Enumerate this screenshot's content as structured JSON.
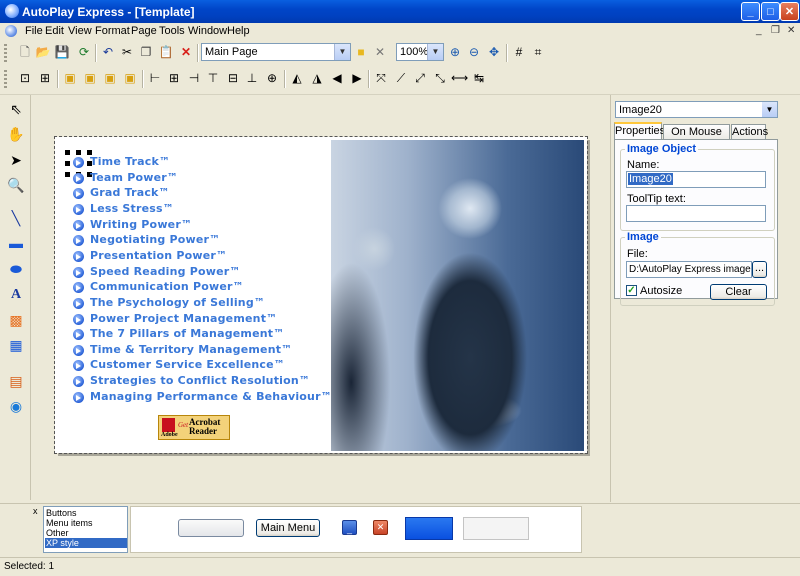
{
  "window": {
    "title": "AutoPlay Express - [Template]"
  },
  "menu": [
    "File",
    "Edit",
    "View",
    "Format",
    "Page",
    "Tools",
    "Window",
    "Help"
  ],
  "toolbar": {
    "page_combo_value": "Main Page",
    "zoom_combo_value": "100%"
  },
  "canvas": {
    "links": [
      "Time Track™",
      "Team Power™",
      "Grad Track™",
      "Less Stress™",
      "Writing Power™",
      "Negotiating Power™",
      "Presentation Power™",
      "Speed Reading Power™",
      "Communication Power™",
      "The Psychology of Selling™",
      "Power Project Management™",
      "The 7 Pillars of Management™",
      "Time & Territory Management™",
      "Customer Service Excellence™",
      "Strategies to Conflict Resolution™",
      "Managing Performance & Behaviour™"
    ],
    "acrobat": {
      "adobe": "Adobe",
      "get": "Get",
      "product_line1": "Acrobat",
      "product_line2": "Reader"
    }
  },
  "properties": {
    "object_combo_value": "Image20",
    "tabs": [
      "Properties",
      "On Mouse Over",
      "Actions"
    ],
    "active_tab": "Properties",
    "image_object_group": "Image Object",
    "name_label": "Name:",
    "name_value": "Image20",
    "tooltip_label": "ToolTip text:",
    "tooltip_value": "",
    "image_group": "Image",
    "file_label": "File:",
    "file_value": "D:\\AutoPlay Express images\\_.p",
    "browse_label": "...",
    "autosize_label": "Autosize",
    "autosize_checked": true,
    "clear_label": "Clear"
  },
  "bottom": {
    "style_list": [
      "Buttons",
      "Menu items",
      "Other",
      "XP style"
    ],
    "selected_style": "XP style",
    "close_label": "x",
    "main_menu_label": "Main Menu"
  },
  "status": {
    "text": "Selected: 1"
  },
  "colors": {
    "link_text": "#3a78d8",
    "title_bar": "#0045c8",
    "selection": "#316ac5"
  }
}
